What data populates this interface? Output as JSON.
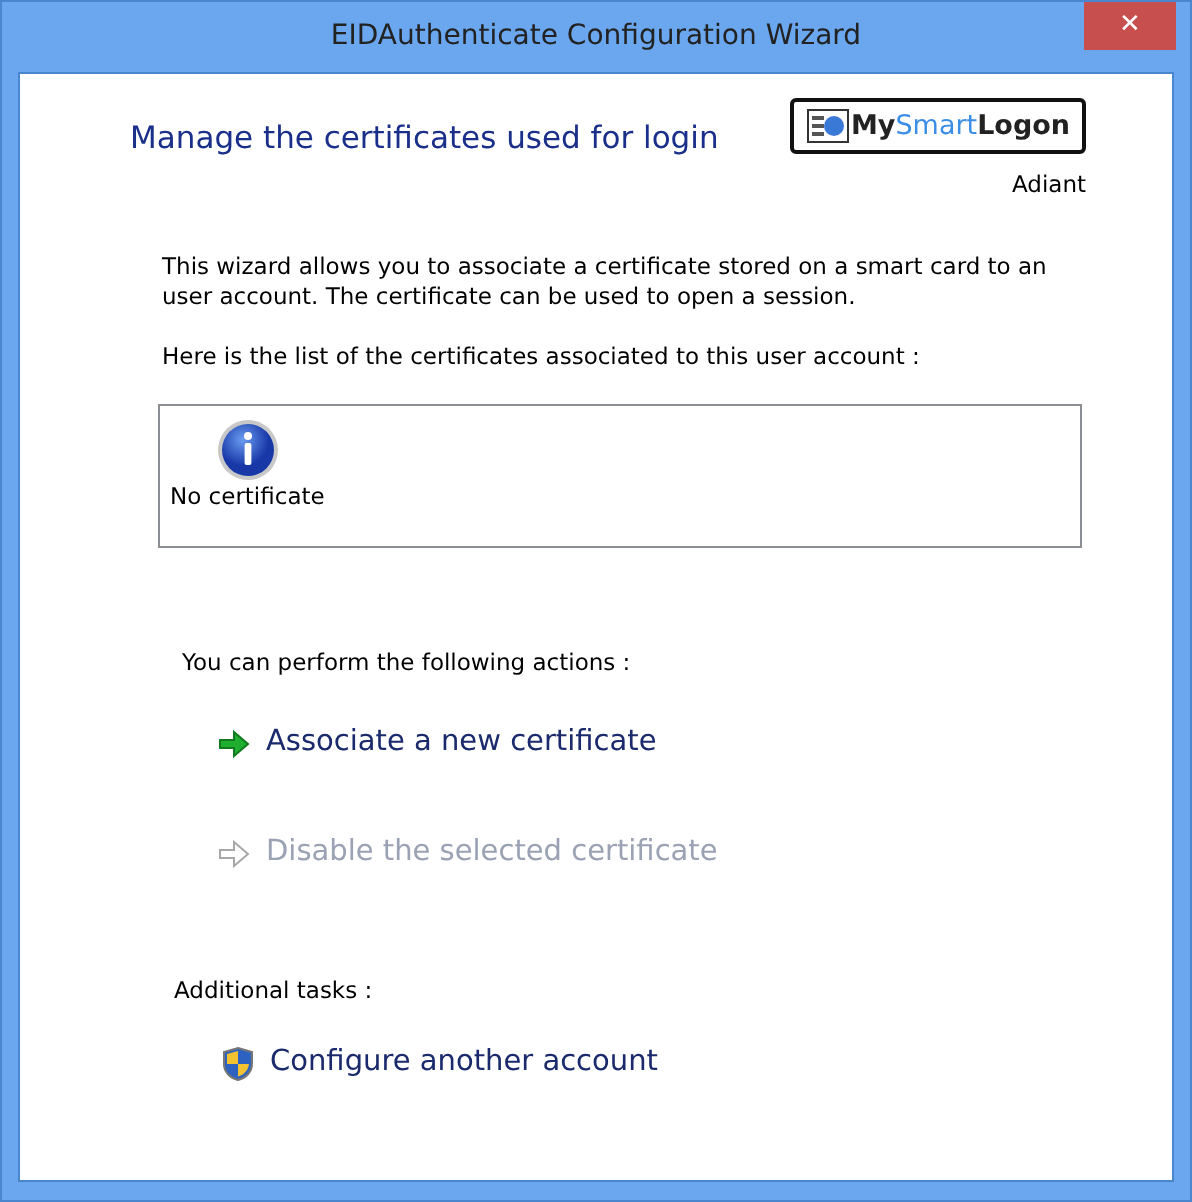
{
  "window": {
    "title": "EIDAuthenticate Configuration Wizard",
    "close": "✕"
  },
  "header": {
    "title": "Manage the certificates used for login",
    "logo_parts": [
      {
        "text": "My",
        "kind": "plain"
      },
      {
        "text": "Smart",
        "kind": "accent"
      },
      {
        "text": "Logon",
        "kind": "plain"
      }
    ],
    "company": "Adiant"
  },
  "intro": "This wizard allows you to associate a certificate stored on a smart card to an user account. The certificate can be used to open a session.",
  "list_caption": "Here is the list of the certificates associated to this user account :",
  "certificates": [
    {
      "label": "No certificate",
      "kind": "info"
    }
  ],
  "actions_caption": "You can perform the following actions :",
  "actions": [
    {
      "label": "Associate a new certificate",
      "kind": "arrow",
      "disabled": false
    },
    {
      "label": "Disable the selected certificate",
      "kind": "arrow",
      "disabled": true
    }
  ],
  "tasks_caption": "Additional tasks :",
  "tasks": [
    {
      "label": "Configure another account",
      "kind": "shield",
      "disabled": false
    }
  ]
}
